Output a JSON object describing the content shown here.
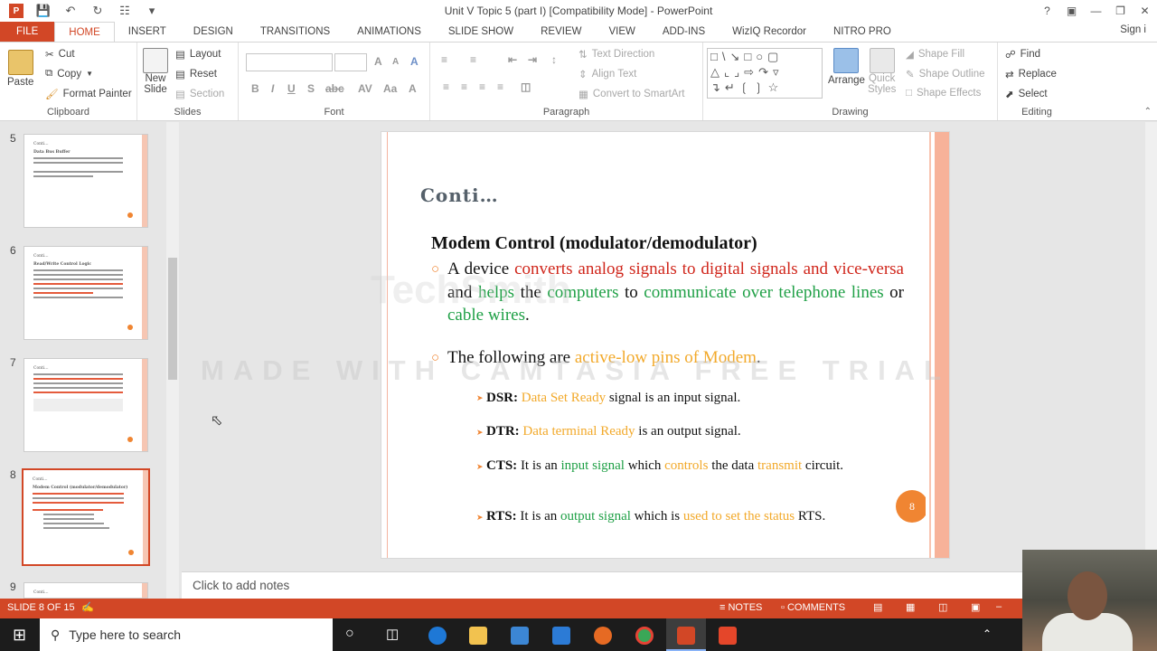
{
  "window": {
    "title": "Unit V Topic 5 (part I) [Compatibility Mode] - PowerPoint",
    "signin": "Sign i"
  },
  "tabs": [
    "FILE",
    "HOME",
    "INSERT",
    "DESIGN",
    "TRANSITIONS",
    "ANIMATIONS",
    "SLIDE SHOW",
    "REVIEW",
    "VIEW",
    "ADD-INS",
    "WizIQ Recordor",
    "NITRO PRO"
  ],
  "ribbon": {
    "clipboard": {
      "label": "Clipboard",
      "paste": "Paste",
      "cut": "Cut",
      "copy": "Copy",
      "format_painter": "Format Painter"
    },
    "slides": {
      "label": "Slides",
      "new_slide": "New",
      "new_slide2": "Slide",
      "layout": "Layout",
      "reset": "Reset",
      "section": "Section"
    },
    "font": {
      "label": "Font"
    },
    "paragraph": {
      "label": "Paragraph",
      "text_direction": "Text Direction",
      "align_text": "Align Text",
      "convert_smartart": "Convert to SmartArt"
    },
    "drawing": {
      "label": "Drawing",
      "arrange": "Arrange",
      "quick_styles": "Quick",
      "quick_styles2": "Styles",
      "shape_fill": "Shape Fill",
      "shape_outline": "Shape Outline",
      "shape_effects": "Shape Effects"
    },
    "editing": {
      "label": "Editing",
      "find": "Find",
      "replace": "Replace",
      "select": "Select"
    }
  },
  "thumbnails": [
    {
      "num": "5",
      "title": "Conti...",
      "heading": "Data Bus Buffer"
    },
    {
      "num": "6",
      "title": "Conti...",
      "heading": "Read/Write Control Logic"
    },
    {
      "num": "7",
      "title": "Conti...",
      "heading": ""
    },
    {
      "num": "8",
      "title": "Conti...",
      "heading": "Modem Control (modulator/demodulator)"
    },
    {
      "num": "9",
      "title": "Conti...",
      "heading": ""
    }
  ],
  "slide": {
    "title": "Conti…",
    "subtitle": "Modem Control (modulator/demodulator)",
    "b1": {
      "p1": "A device ",
      "p2": "converts analog signals to digital signals and vice-versa",
      "p3": " and ",
      "p4": "helps",
      "p5": " the ",
      "p6": "computers",
      "p7": " to ",
      "p8": "communicate over telephone lines",
      "p9": " or ",
      "p10": "cable wires",
      "p11": "."
    },
    "b2": {
      "p1": "The following are ",
      "p2": "active-low pins of Modem",
      "p3": "."
    },
    "dsr": {
      "k": "DSR:",
      "v1": " Data Set Ready",
      "v2": " signal is an input signal."
    },
    "dtr": {
      "k": "DTR:",
      "v1": " Data terminal Ready",
      "v2": " is an output signal."
    },
    "cts": {
      "k": "CTS:",
      "v1": " It is an ",
      "v2": "input signal",
      "v3": " which ",
      "v4": "controls",
      "v5": " the data ",
      "v6": "transmit",
      "v7": " circuit."
    },
    "rts": {
      "k": "RTS:",
      "v1": " It is an ",
      "v2": "output signal",
      "v3": " which is ",
      "v4": "used to set the status",
      "v5": " RTS."
    },
    "page_badge": "8",
    "watermark": "MADE WITH CAMTASIA FREE TRIAL",
    "watermark2": "TechSmith"
  },
  "notes_placeholder": "Click to add notes",
  "status": {
    "slide_info": "SLIDE 8 OF 15",
    "notes": "NOTES",
    "comments": "COMMENTS"
  },
  "taskbar": {
    "search_placeholder": "Type here to search"
  }
}
